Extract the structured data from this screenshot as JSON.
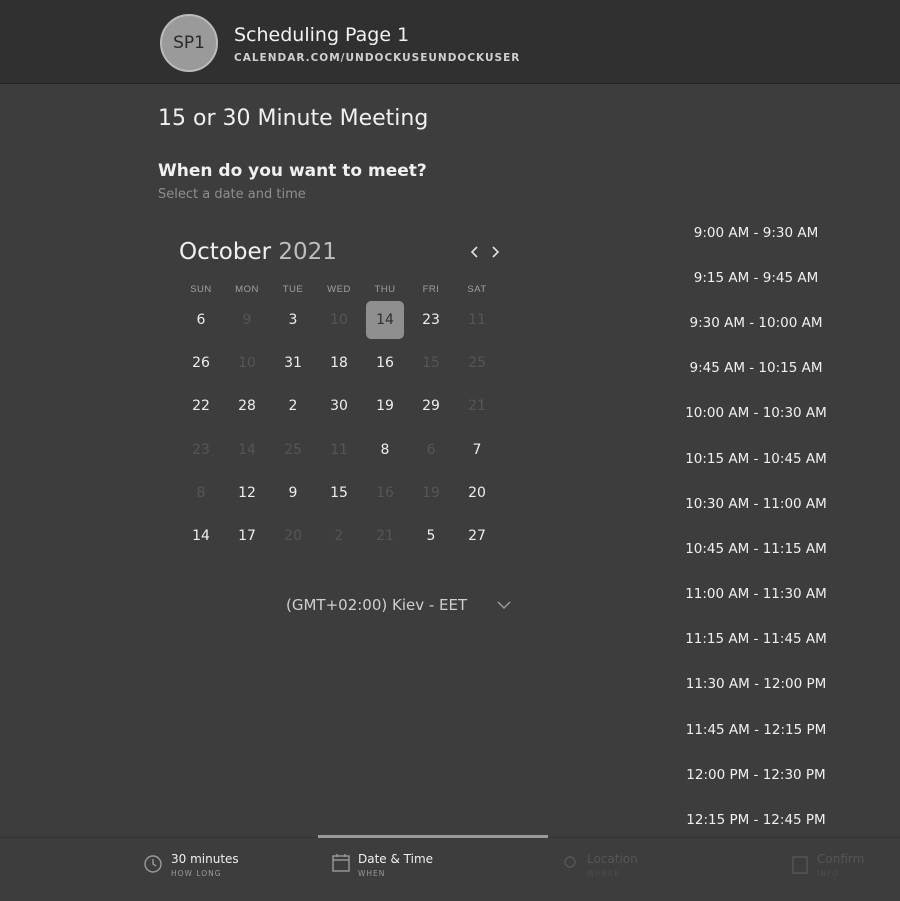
{
  "header": {
    "avatar_initials": "SP1",
    "page_name": "Scheduling Page 1",
    "page_url": "CALENDAR.COM/UNDOCKUSEUNDOCKUSER"
  },
  "event": {
    "title": "15 or 30 Minute Meeting",
    "question": "When do you want to meet?",
    "hint": "Select a date and time"
  },
  "calendar": {
    "month": "October",
    "year": "2021",
    "weekdays": [
      "SUN",
      "MON",
      "TUE",
      "WED",
      "THU",
      "FRI",
      "SAT"
    ],
    "selected_day": "14",
    "weeks": [
      [
        "6",
        "9",
        "3",
        "10",
        "14",
        "23",
        "11"
      ],
      [
        "26",
        "10",
        "31",
        "18",
        "16",
        "15",
        "25"
      ],
      [
        "22",
        "28",
        "2",
        "30",
        "19",
        "29",
        "21"
      ],
      [
        "23",
        "14",
        "25",
        "11",
        "8",
        "6",
        "7"
      ],
      [
        "8",
        "12",
        "9",
        "15",
        "16",
        "19",
        "20"
      ],
      [
        "14",
        "17",
        "20",
        "2",
        "21",
        "5",
        "27"
      ]
    ],
    "dim": [
      [
        false,
        true,
        false,
        true,
        false,
        false,
        true
      ],
      [
        false,
        true,
        false,
        false,
        false,
        true,
        true
      ],
      [
        false,
        false,
        false,
        false,
        false,
        false,
        true
      ],
      [
        true,
        true,
        true,
        true,
        false,
        true,
        false
      ],
      [
        true,
        false,
        false,
        false,
        true,
        true,
        false
      ],
      [
        false,
        false,
        true,
        true,
        true,
        false,
        false
      ]
    ]
  },
  "timezone": {
    "label": "(GMT+02:00) Kiev - EET"
  },
  "time_slots": [
    "9:00 AM - 9:30 AM",
    "9:15 AM - 9:45 AM",
    "9:30 AM - 10:00 AM",
    "9:45 AM - 10:15 AM",
    "10:00 AM - 10:30 AM",
    "10:15 AM - 10:45 AM",
    "10:30 AM - 11:00 AM",
    "10:45 AM - 11:15 AM",
    "11:00 AM - 11:30 AM",
    "11:15 AM - 11:45 AM",
    "11:30 AM - 12:00 PM",
    "11:45 AM - 12:15 PM",
    "12:00 PM - 12:30 PM",
    "12:15 PM - 12:45 PM"
  ],
  "steps": {
    "duration": {
      "label": "30 minutes",
      "sub": "HOW LONG"
    },
    "datetime": {
      "label": "Date & Time",
      "sub": "WHEN"
    },
    "location": {
      "label": "Location",
      "sub": "WHERE"
    },
    "details": {
      "label": "Confirm",
      "sub": "INFO"
    }
  },
  "icons": {
    "prev": "chevron-left-icon",
    "next": "chevron-right-icon",
    "timezone": "chevron-down-icon",
    "duration": "clock-icon",
    "datetime": "calendar-icon",
    "location": "pin-icon",
    "details": "document-icon"
  },
  "colors": {
    "background": "#3d3d3d",
    "header": "#303030",
    "selected_day": "#8f8f8f"
  }
}
